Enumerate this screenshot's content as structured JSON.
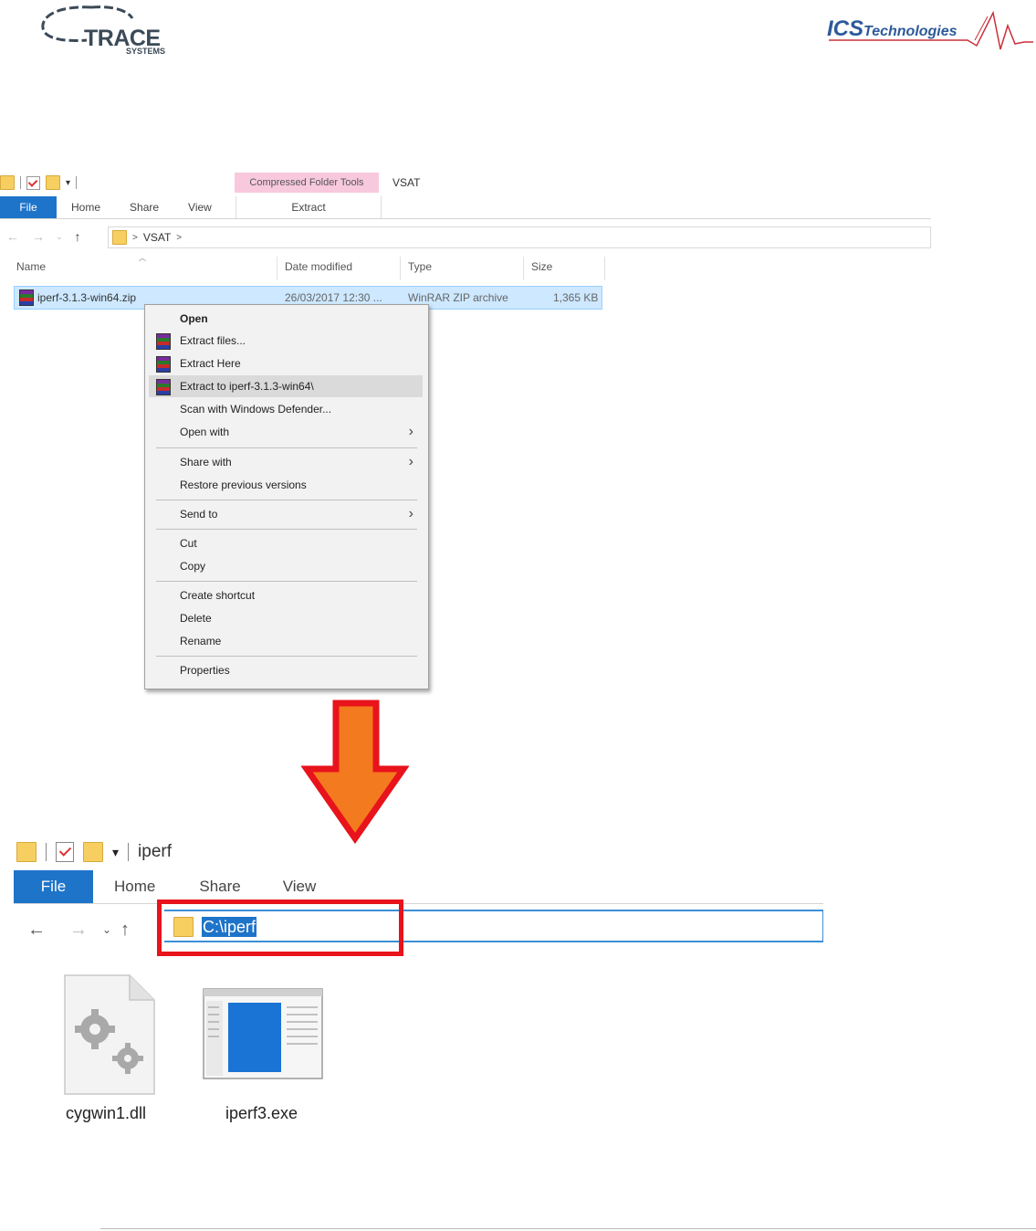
{
  "logos": {
    "left_text": "TRACE",
    "left_sub": "SYSTEMS",
    "right_text_main": "ICS",
    "right_text_rest": "Technologies"
  },
  "explorer1": {
    "contextual_tab_group": "Compressed Folder Tools",
    "window_title": "VSAT",
    "ribbon_tabs": [
      "File",
      "Home",
      "Share",
      "View"
    ],
    "contextual_tab": "Extract",
    "breadcrumb_sep": ">",
    "breadcrumb_folder": "VSAT",
    "columns": {
      "name": "Name",
      "date": "Date modified",
      "type": "Type",
      "size": "Size"
    },
    "file": {
      "name": "iperf-3.1.3-win64.zip",
      "date": "26/03/2017 12:30 ...",
      "type": "WinRAR ZIP archive",
      "size": "1,365 KB"
    }
  },
  "context_menu": {
    "items": [
      {
        "label": "Open"
      },
      {
        "label": "Extract files..."
      },
      {
        "label": "Extract Here"
      },
      {
        "label": "Extract to iperf-3.1.3-win64\\"
      },
      {
        "label": "Scan with Windows Defender..."
      },
      {
        "label": "Open with"
      },
      {
        "label": "Share with"
      },
      {
        "label": "Restore previous versions"
      },
      {
        "label": "Send to"
      },
      {
        "label": "Cut"
      },
      {
        "label": "Copy"
      },
      {
        "label": "Create shortcut"
      },
      {
        "label": "Delete"
      },
      {
        "label": "Rename"
      },
      {
        "label": "Properties"
      }
    ]
  },
  "explorer2": {
    "window_title": "iperf",
    "ribbon_tabs": [
      "File",
      "Home",
      "Share",
      "View"
    ],
    "address": "C:\\iperf",
    "files": [
      {
        "name": "cygwin1.dll",
        "icon": "dll-settings-icon"
      },
      {
        "name": "iperf3.exe",
        "icon": "exe-application-icon"
      }
    ]
  },
  "colors": {
    "accent_blue": "#1e74c9",
    "highlight_red": "#e8131b",
    "arrow_fill": "#f47a1f",
    "contextual_pink": "#f8c9dc"
  }
}
